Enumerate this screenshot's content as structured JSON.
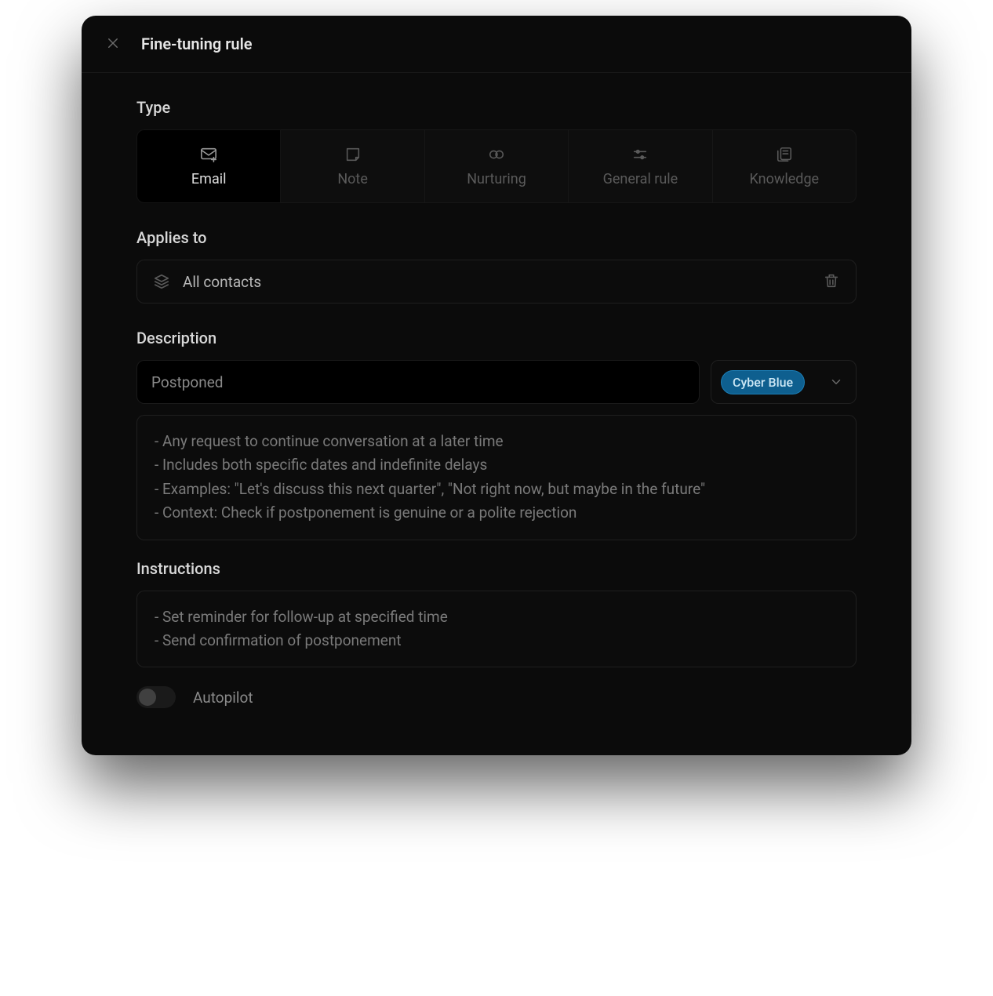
{
  "header": {
    "title": "Fine-tuning rule"
  },
  "type": {
    "label": "Type",
    "options": [
      {
        "label": "Email",
        "selected": true
      },
      {
        "label": "Note",
        "selected": false
      },
      {
        "label": "Nurturing",
        "selected": false
      },
      {
        "label": "General rule",
        "selected": false
      },
      {
        "label": "Knowledge",
        "selected": false
      }
    ]
  },
  "applies_to": {
    "label": "Applies to",
    "value": "All contacts"
  },
  "description": {
    "label": "Description",
    "title": "Postponed",
    "color_label": "Cyber Blue",
    "body": "- Any request to continue conversation at a later time\n- Includes both specific dates and indefinite delays\n- Examples: \"Let's discuss this next quarter\", \"Not right now, but maybe in the future\"\n- Context: Check if postponement is genuine or a polite rejection"
  },
  "instructions": {
    "label": "Instructions",
    "body": "- Set reminder for follow-up at specified time\n- Send confirmation of postponement"
  },
  "autopilot": {
    "label": "Autopilot",
    "enabled": false
  }
}
